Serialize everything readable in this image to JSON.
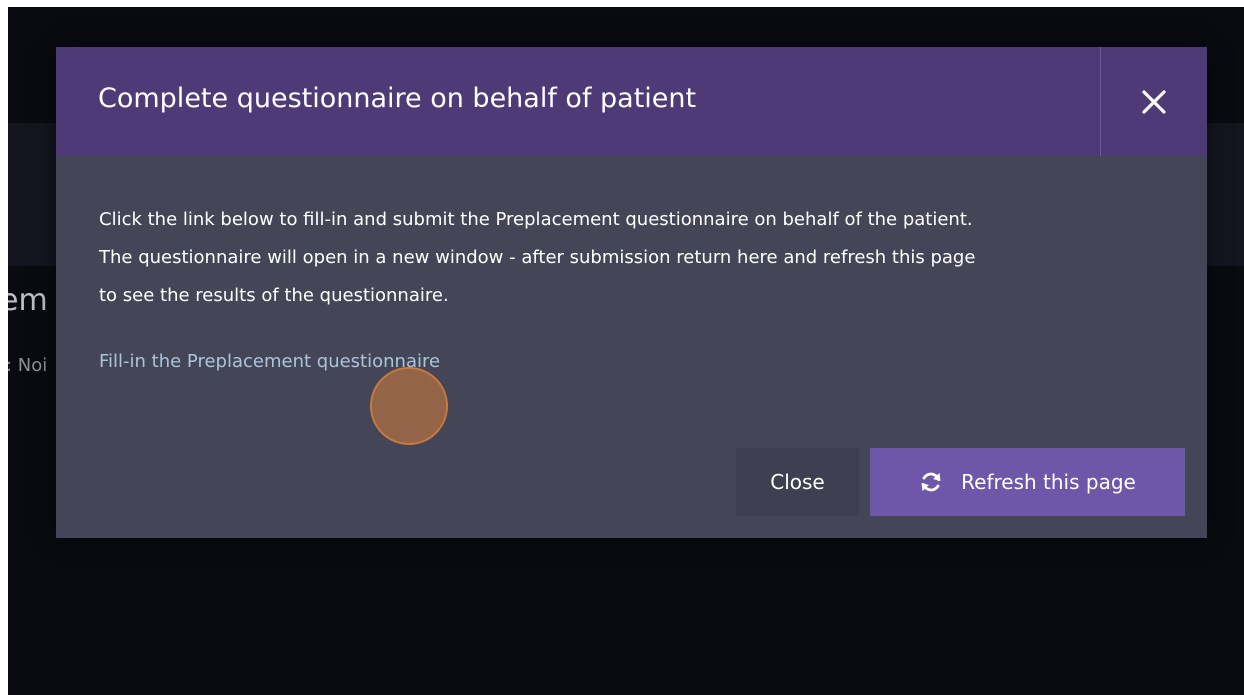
{
  "background": {
    "heading_fragment": "em",
    "sub_fragment": ": Noi"
  },
  "modal": {
    "title": "Complete questionnaire on behalf of patient",
    "close_icon": "close-x-icon",
    "body_lines": [
      "Click the link below to fill-in and submit the Preplacement questionnaire on behalf of the patient.",
      "The questionnaire will open in a new window - after submission return here and refresh this page",
      "to see the results of the questionnaire."
    ],
    "link_text": "Fill-in the Preplacement questionnaire",
    "close_button_label": "Close",
    "refresh_button_label": "Refresh this page",
    "refresh_icon": "refresh-icon"
  },
  "colors": {
    "header": "#4f3a78",
    "body": "#444658",
    "primary_button": "#6e56a8",
    "link": "#a8c5dc"
  }
}
